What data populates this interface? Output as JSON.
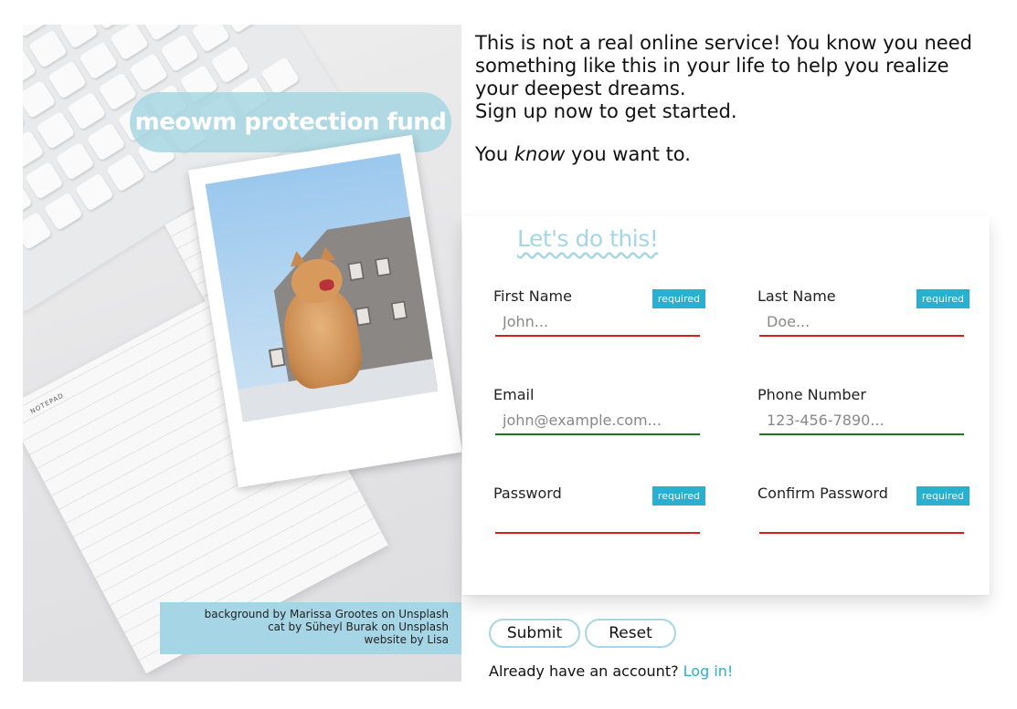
{
  "brand": {
    "name": "meowm protection fund"
  },
  "hero": {
    "notepad_label": "NOTEPAD",
    "credits": [
      "background by Marissa Grootes on Unsplash",
      "cat by Süheyl Burak on Unsplash",
      "website by Lisa"
    ]
  },
  "intro": {
    "line1": "This is not a real online service! You know you need something like this in your life to help you realize your deepest dreams.",
    "line2": "Sign up now to get started.",
    "know_before": "You ",
    "know_em": "know",
    "know_after": " you want to."
  },
  "form": {
    "title": "Let's do this!",
    "required_badge": "required",
    "first_name": {
      "label": "First Name",
      "placeholder": "John...",
      "required": true,
      "valid": false
    },
    "last_name": {
      "label": "Last Name",
      "placeholder": "Doe...",
      "required": true,
      "valid": false
    },
    "email": {
      "label": "Email",
      "placeholder": "john@example.com...",
      "required": false,
      "valid": true
    },
    "phone": {
      "label": "Phone Number",
      "placeholder": "123-456-7890...",
      "required": false,
      "valid": true
    },
    "password": {
      "label": "Password",
      "placeholder": "",
      "required": true,
      "valid": false
    },
    "confirm_password": {
      "label": "Confirm Password",
      "placeholder": "",
      "required": true,
      "valid": false
    }
  },
  "actions": {
    "submit_label": "Submit",
    "reset_label": "Reset",
    "already_text": "Already have an account? ",
    "login_link": "Log in!"
  },
  "colors": {
    "accent": "#a6d6e5",
    "badge": "#29afd0",
    "invalid": "#dd1c1c",
    "valid": "#1a7a22"
  }
}
